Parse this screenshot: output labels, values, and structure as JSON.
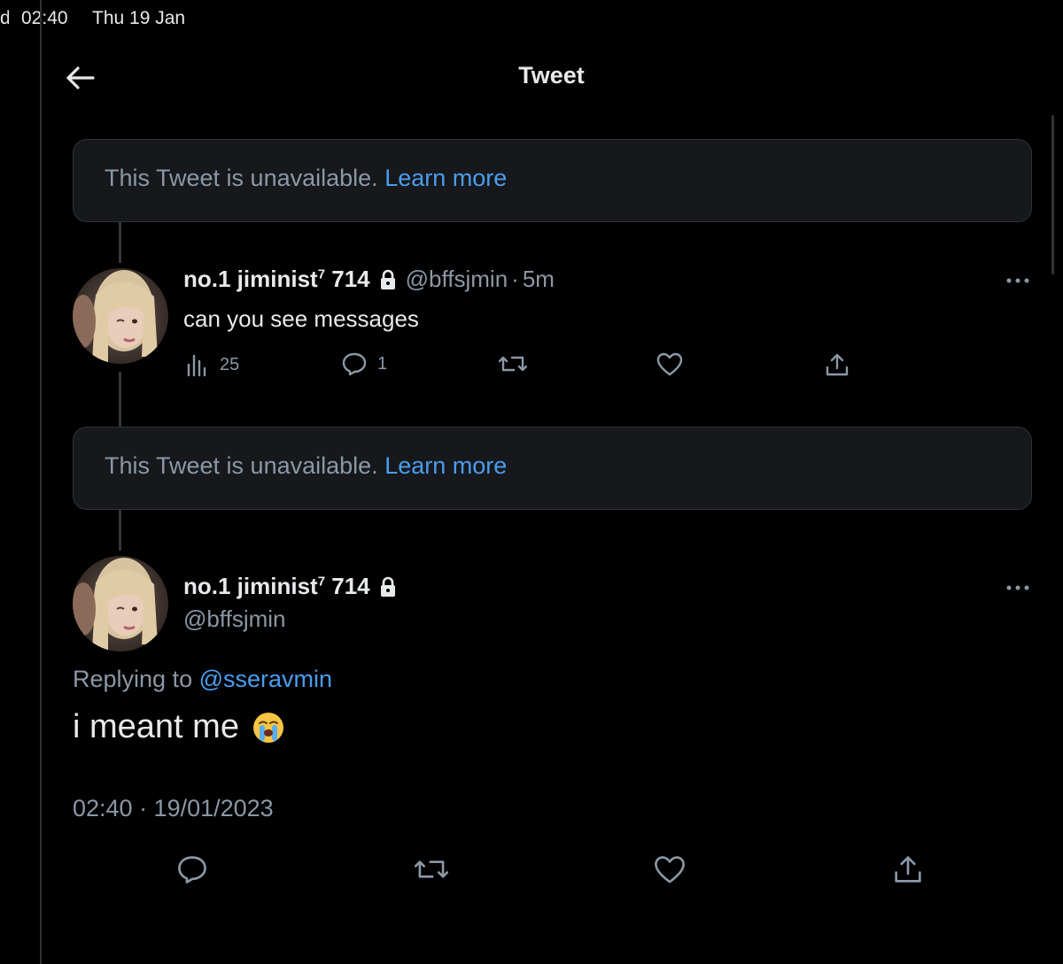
{
  "status_bar": {
    "edge_text": "d",
    "time": "02:40",
    "date": "Thu 19 Jan"
  },
  "header": {
    "title": "Tweet",
    "back_icon": "arrow-left-icon"
  },
  "unavailable_notices": [
    {
      "text": "This Tweet is unavailable.",
      "link": "Learn more"
    },
    {
      "text": "This Tweet is unavailable.",
      "link": "Learn more"
    }
  ],
  "reply_tweet": {
    "display_name": "no.1 jiminist",
    "name_sup": "7",
    "name_suffix": "714",
    "handle": "@bffsjmin",
    "separator": "·",
    "time": "5m",
    "text": "can you see messages",
    "stats": {
      "views": "25",
      "replies": "1"
    }
  },
  "main_tweet": {
    "display_name": "no.1 jiminist",
    "name_sup": "7",
    "name_suffix": "714",
    "handle": "@bffsjmin",
    "replying_prefix": "Replying to",
    "replying_to": "@sseravmin",
    "text": "i meant me",
    "emoji": "loudly-crying-face",
    "timestamp": "02:40 · 19/01/2023"
  },
  "colors": {
    "background": "#000000",
    "text_primary": "#e7e9ea",
    "text_secondary": "#8b98a5",
    "link": "#4a9ded",
    "notice_bg": "#16181c",
    "border": "#2f3336"
  }
}
